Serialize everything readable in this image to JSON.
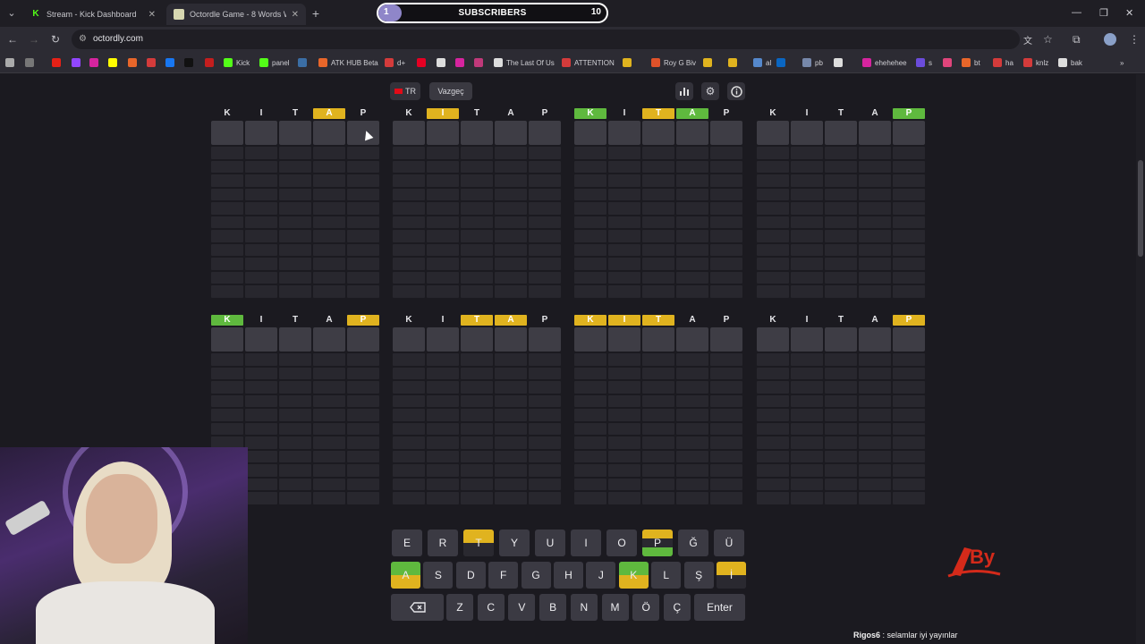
{
  "browser": {
    "tabs": [
      {
        "title": "Stream - Kick Dashboard",
        "favicon": "kick-logo-icon",
        "active": false
      },
      {
        "title": "Octordle Game - 8 Words Wor",
        "favicon": "octordle-icon",
        "active": true
      }
    ],
    "url": "octordly.com",
    "bookmarks": [
      "Kick",
      "panel",
      "ATK HUB Beta",
      "d+",
      "The Last Of Us",
      "ATTENTION",
      "Roy G Biv",
      "al",
      "pb",
      "ehehehee",
      "s",
      "bt",
      "ha",
      "knlz",
      "bak"
    ]
  },
  "overlay": {
    "subscribers_label": "SUBSCRIBERS",
    "current": "1",
    "goal": "10",
    "progress_fraction": 0.1
  },
  "toolbar": {
    "language_label": "TR",
    "give_up_label": "Vazgeç",
    "icons": [
      "bar-chart-icon",
      "gear-icon",
      "info-icon"
    ]
  },
  "boards": [
    {
      "guess": [
        "K",
        "I",
        "T",
        "A",
        "P"
      ],
      "states": [
        "n",
        "n",
        "n",
        "p",
        "n"
      ]
    },
    {
      "guess": [
        "K",
        "I",
        "T",
        "A",
        "P"
      ],
      "states": [
        "n",
        "p",
        "n",
        "n",
        "n"
      ]
    },
    {
      "guess": [
        "K",
        "I",
        "T",
        "A",
        "P"
      ],
      "states": [
        "c",
        "n",
        "p",
        "c",
        "n"
      ]
    },
    {
      "guess": [
        "K",
        "I",
        "T",
        "A",
        "P"
      ],
      "states": [
        "n",
        "n",
        "n",
        "n",
        "c"
      ]
    },
    {
      "guess": [
        "K",
        "I",
        "T",
        "A",
        "P"
      ],
      "states": [
        "c",
        "n",
        "n",
        "n",
        "p"
      ]
    },
    {
      "guess": [
        "K",
        "I",
        "T",
        "A",
        "P"
      ],
      "states": [
        "n",
        "n",
        "p",
        "p",
        "n"
      ]
    },
    {
      "guess": [
        "K",
        "I",
        "T",
        "A",
        "P"
      ],
      "states": [
        "p",
        "p",
        "p",
        "n",
        "n"
      ]
    },
    {
      "guess": [
        "K",
        "I",
        "T",
        "A",
        "P"
      ],
      "states": [
        "n",
        "n",
        "n",
        "n",
        "p"
      ]
    }
  ],
  "keyboard": {
    "row1": [
      "E",
      "R",
      "T",
      "Y",
      "U",
      "I",
      "O",
      "P",
      "Ğ",
      "Ü"
    ],
    "row2": [
      "A",
      "S",
      "D",
      "F",
      "G",
      "H",
      "J",
      "K",
      "L",
      "Ş",
      "İ"
    ],
    "row3": [
      "Z",
      "C",
      "V",
      "B",
      "N",
      "M",
      "Ö",
      "Ç"
    ],
    "enter_label": "Enter",
    "backspace_icon": "backspace-icon"
  },
  "chat": {
    "user": "Rigos6",
    "message": " : selamlar iyi yayınlar"
  },
  "colors": {
    "correct": "#5fb93e",
    "present": "#e0b31f",
    "key_bg": "#3b3a43",
    "cell_bg": "#3e3d45"
  }
}
